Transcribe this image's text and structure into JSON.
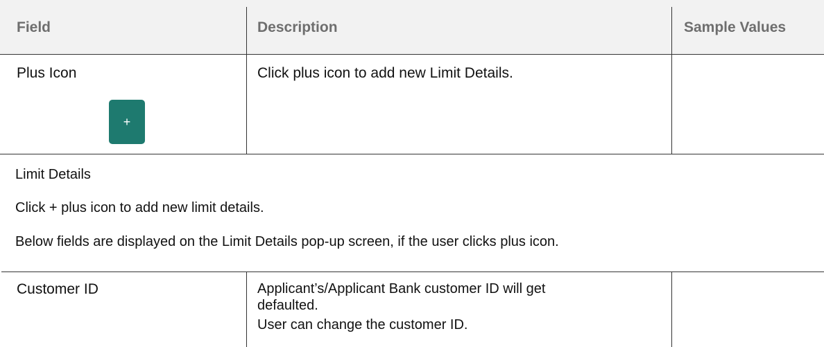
{
  "table1": {
    "headers": {
      "field": "Field",
      "description": "Description",
      "sample": "Sample Values"
    },
    "rows": [
      {
        "field": "Plus Icon",
        "description": "Click plus icon to add new Limit Details.",
        "sample": "",
        "button_label": "+"
      }
    ]
  },
  "section": {
    "heading": "Limit Details",
    "para1": "Click + plus icon to add new limit details.",
    "para2": "Below fields are displayed on the Limit Details pop-up screen, if the user clicks plus icon."
  },
  "table2": {
    "rows": [
      {
        "field": "Customer ID",
        "description_lines": [
          "Applicant’s/Applicant Bank customer ID will get",
          "defaulted.",
          "User can change the customer ID."
        ],
        "sample": ""
      }
    ]
  },
  "colors": {
    "accent": "#1e7a6f",
    "header_bg": "#f2f2f2",
    "header_text": "#6e6e6e"
  }
}
